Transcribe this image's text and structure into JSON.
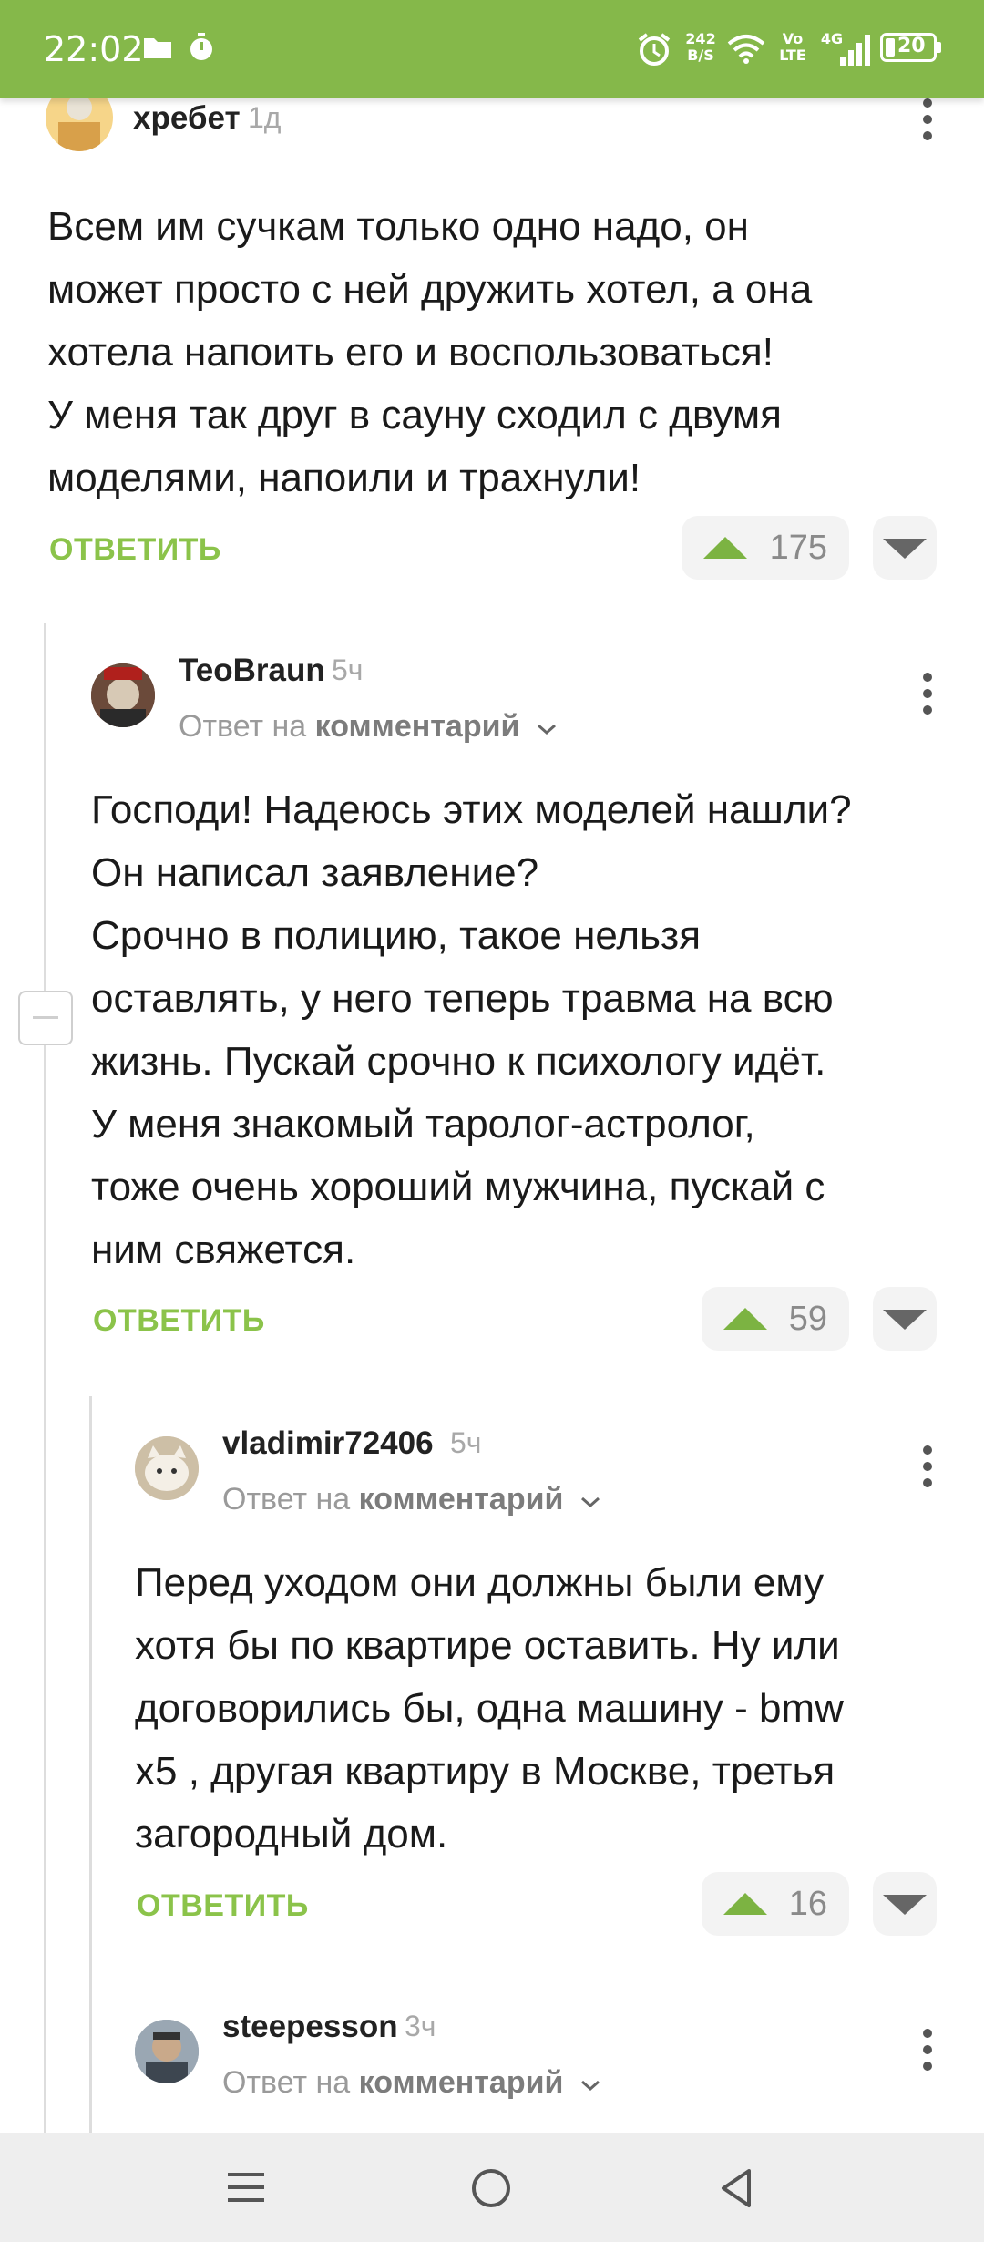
{
  "status_bar": {
    "time": "22:02",
    "net_speed_value": "242",
    "net_speed_unit": "B/S",
    "volte_top": "Vo",
    "volte_bottom": "LTE",
    "network": "4G",
    "battery": "20"
  },
  "comments": [
    {
      "username": "хребет",
      "time": "1д",
      "text": "Всем им сучкам только одно надо, он\nможет просто с ней дружить хотел, а она\nхотела напоить его и воспользоваться!\nУ меня так друг в сауну сходил с двумя\nмоделями, напоили и трахнули!",
      "reply_label": "ОТВЕТИТЬ",
      "votes": "175"
    },
    {
      "username": "TeoBraun",
      "time": "5ч",
      "reply_prefix": "Ответ на",
      "reply_target": "комментарий",
      "text": "Господи! Надеюсь этих моделей нашли?\nОн написал заявление?\nСрочно в полицию, такое нельзя\nоставлять, у него теперь травма на всю\nжизнь. Пускай срочно к психологу идёт.\nУ меня знакомый таролог-астролог,\nтоже очень хороший мужчина, пускай с\nним свяжется.",
      "reply_label": "ОТВЕТИТЬ",
      "votes": "59"
    },
    {
      "username": "vladimir72406",
      "time": "5ч",
      "reply_prefix": "Ответ на",
      "reply_target": "комментарий",
      "text": "Перед уходом они должны были ему\nхотя бы по квартире оставить. Ну или\nдоговорились бы, одна машину - bmw\nx5 , другая квартиру в Москве, третья\nзагородный дом.",
      "reply_label": "ОТВЕТИТЬ",
      "votes": "16"
    },
    {
      "username": "steepesson",
      "time": "3ч",
      "reply_prefix": "Ответ на",
      "reply_target": "комментарий"
    }
  ],
  "icons": [
    "folder-icon",
    "timer-icon",
    "alarm-icon",
    "wifi-icon",
    "signal-icon",
    "battery-icon",
    "kebab-menu-icon",
    "chevron-down-icon",
    "upvote-icon",
    "downvote-icon",
    "collapse-icon",
    "menu-icon",
    "home-icon",
    "back-icon"
  ],
  "colors": {
    "status_bar": "#85b84a",
    "accent_green": "#8bc34a",
    "upvote": "#7cb342",
    "nav_bar": "#eeeeee"
  }
}
